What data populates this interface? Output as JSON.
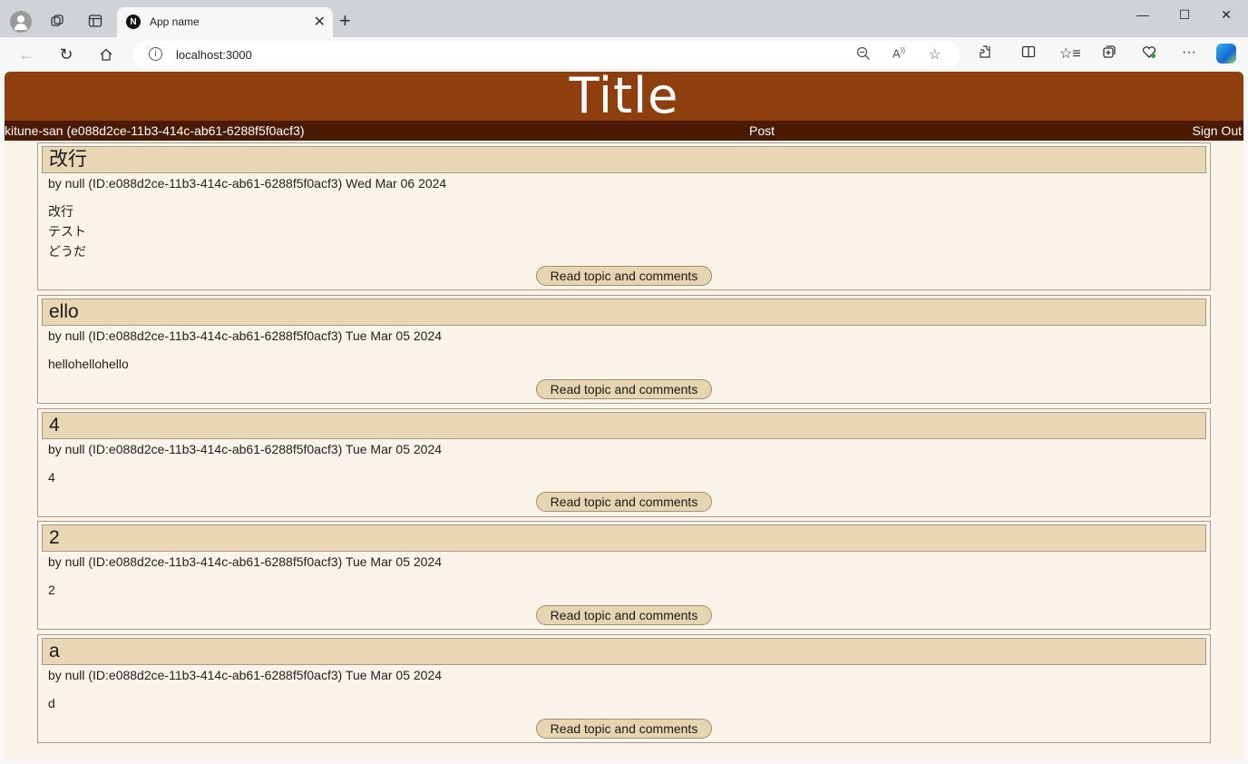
{
  "browser": {
    "tab_title": "App name",
    "tab_favicon_letter": "N",
    "url": "localhost:3000"
  },
  "site": {
    "title": "Title",
    "nav": {
      "user": "kitune-san (e088d2ce-11b3-414c-ab61-6288f5f0acf3)",
      "post": "Post",
      "sign_out": "Sign Out"
    }
  },
  "posts": [
    {
      "title": "改行",
      "meta": "by null (ID:e088d2ce-11b3-414c-ab61-6288f5f0acf3) Wed Mar 06 2024",
      "body": "改行\nテスト\nどうだ",
      "button": "Read topic and comments"
    },
    {
      "title": "ello",
      "meta": "by null (ID:e088d2ce-11b3-414c-ab61-6288f5f0acf3) Tue Mar 05 2024",
      "body": "hellohellohello",
      "button": "Read topic and comments"
    },
    {
      "title": "4",
      "meta": "by null (ID:e088d2ce-11b3-414c-ab61-6288f5f0acf3) Tue Mar 05 2024",
      "body": "4",
      "button": "Read topic and comments"
    },
    {
      "title": "2",
      "meta": "by null (ID:e088d2ce-11b3-414c-ab61-6288f5f0acf3) Tue Mar 05 2024",
      "body": "2",
      "button": "Read topic and comments"
    },
    {
      "title": "a",
      "meta": "by null (ID:e088d2ce-11b3-414c-ab61-6288f5f0acf3) Tue Mar 05 2024",
      "body": "d",
      "button": "Read topic and comments"
    }
  ],
  "colors": {
    "header_bg": "#8f3f0d",
    "navbar_bg": "#4a1a04",
    "page_bg": "#f9f3ea",
    "post_title_bg": "#e8d6b5",
    "button_bg": "#e7d4b0"
  }
}
